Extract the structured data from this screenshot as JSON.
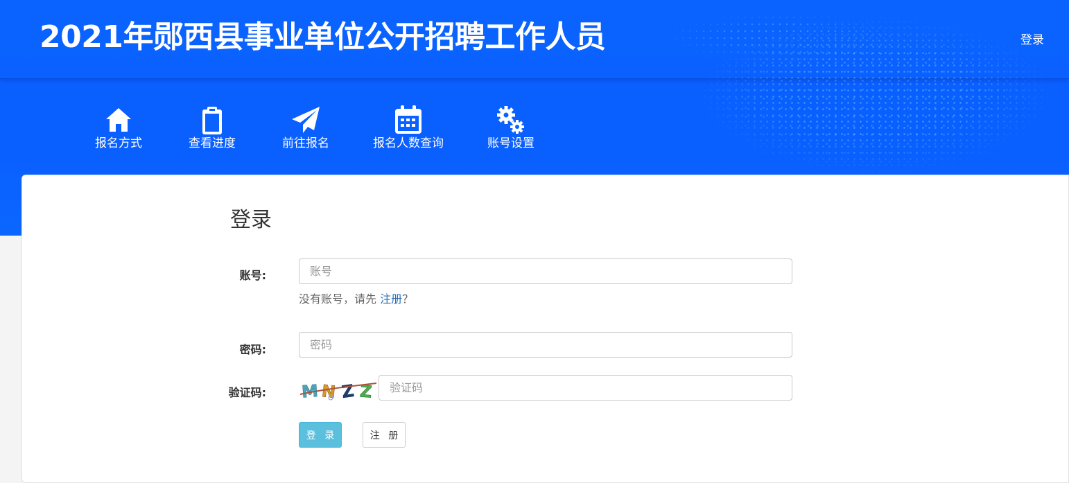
{
  "header": {
    "title": "2021年郧西县事业单位公开招聘工作人员",
    "login_link": "登录"
  },
  "nav": {
    "items": [
      {
        "label": "报名方式",
        "icon": "home-icon"
      },
      {
        "label": "查看进度",
        "icon": "clipboard-icon"
      },
      {
        "label": "前往报名",
        "icon": "paper-plane-icon"
      },
      {
        "label": "报名人数查询",
        "icon": "calendar-icon"
      },
      {
        "label": "账号设置",
        "icon": "gears-icon"
      }
    ]
  },
  "form": {
    "title": "登录",
    "account_label": "账号:",
    "account_placeholder": "账号",
    "hint_prefix": "没有账号，请先",
    "hint_link": "注册",
    "hint_suffix": "？",
    "password_label": "密码:",
    "password_placeholder": "密码",
    "captcha_label": "验证码:",
    "captcha_text": "MNZZ",
    "captcha_placeholder": "验证码",
    "login_button": "登 录",
    "register_button": "注 册"
  },
  "colors": {
    "banner_blue": "#0a63ff",
    "login_button": "#5bc0de",
    "link": "#2a6fb5"
  }
}
